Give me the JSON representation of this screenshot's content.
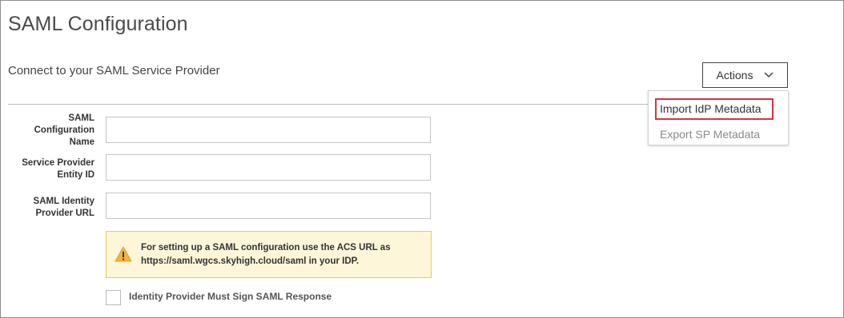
{
  "page": {
    "title": "SAML Configuration",
    "subtitle": "Connect to your SAML Service Provider"
  },
  "actions": {
    "label": "Actions",
    "icon": "chevron-down-icon",
    "menu": {
      "items": [
        {
          "label": "Import IdP Metadata",
          "highlighted": true
        },
        {
          "label": "Export SP Metadata",
          "highlighted": false
        }
      ]
    }
  },
  "form": {
    "fields": [
      {
        "label_lines": [
          "SAML",
          "Configuration",
          "Name"
        ],
        "value": ""
      },
      {
        "label_lines": [
          "Service Provider",
          "Entity ID"
        ],
        "value": ""
      },
      {
        "label_lines": [
          "SAML Identity",
          "Provider URL"
        ],
        "value": ""
      }
    ],
    "alert": {
      "icon": "warning-icon",
      "line1": "For setting up a SAML configuration use the ACS URL as",
      "line2": "https://saml.wgcs.skyhigh.cloud/saml in your IDP."
    },
    "checkbox": {
      "label": "Identity Provider Must Sign SAML Response",
      "checked": false
    }
  },
  "colors": {
    "highlight_border": "#d9333c",
    "alert_background": "#fdf6d8",
    "alert_border": "#e6cc61",
    "warning_icon": "#f2b53b"
  }
}
